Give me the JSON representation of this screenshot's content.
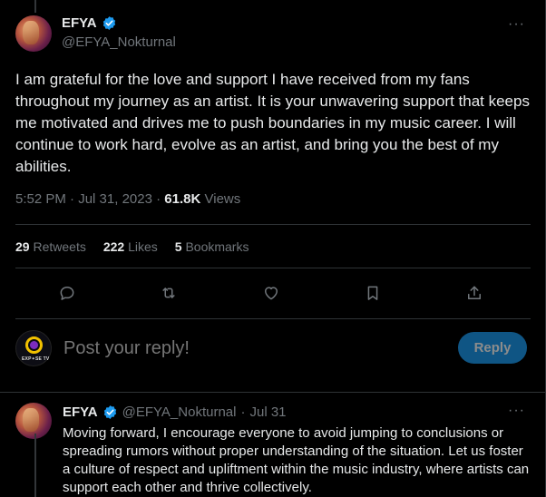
{
  "main_tweet": {
    "display_name": "EFYA",
    "handle": "@EFYA_Nokturnal",
    "text": "I am grateful for the love and support I have received from my fans throughout my journey as an artist. It is your unwavering support that keeps me motivated and drives me to push boundaries in my music career. I will continue to work hard, evolve as an artist, and bring you the best of my abilities.",
    "time": "5:52 PM",
    "date": "Jul 31, 2023",
    "views_count": "61.8K",
    "views_label": "Views",
    "separator": "·",
    "more": "···"
  },
  "stats": {
    "retweets_count": "29",
    "retweets_label": "Retweets",
    "likes_count": "222",
    "likes_label": "Likes",
    "bookmarks_count": "5",
    "bookmarks_label": "Bookmarks"
  },
  "actions": [
    "reply-icon",
    "retweet-icon",
    "like-icon",
    "bookmark-icon",
    "share-icon"
  ],
  "reply_box": {
    "placeholder": "Post your reply!",
    "button_label": "Reply",
    "avatar_text": "EXP✦SE TV"
  },
  "reply_tweet": {
    "display_name": "EFYA",
    "handle": "@EFYA_Nokturnal",
    "separator": "·",
    "date": "Jul 31",
    "text": "Moving forward, I encourage everyone to avoid jumping to conclusions or spreading rumors without proper understanding of the situation. Let us foster a culture of respect and upliftment within the music industry, where artists can support each other and thrive collectively.",
    "more": "···"
  },
  "colors": {
    "background": "#000000",
    "text": "#e7e9ea",
    "muted": "#71767b",
    "accent": "#1d9bf0",
    "divider": "#2f3336"
  }
}
